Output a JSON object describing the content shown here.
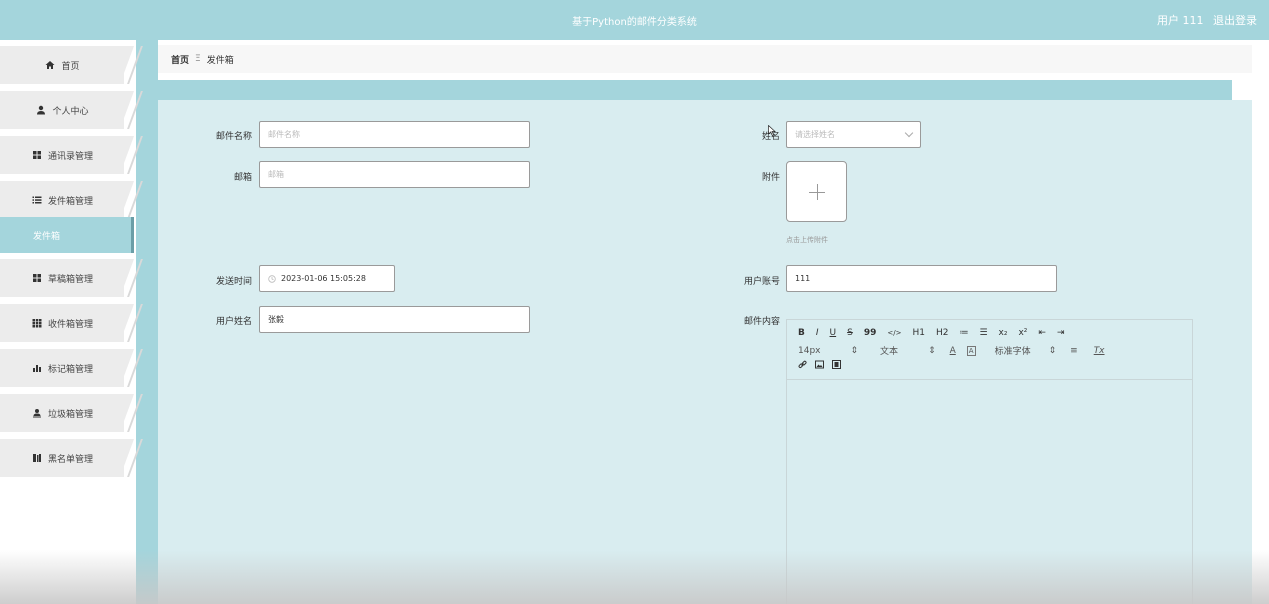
{
  "header": {
    "title": "基于Python的邮件分类系统",
    "user_label": "用户 111",
    "logout_label": "退出登录"
  },
  "sidebar": {
    "items": [
      {
        "label": "首页",
        "icon": "home-icon"
      },
      {
        "label": "个人中心",
        "icon": "user-icon"
      },
      {
        "label": "通讯录管理",
        "icon": "grid-icon"
      },
      {
        "label": "发件箱管理",
        "icon": "list-icon"
      },
      {
        "label": "草稿箱管理",
        "icon": "grid-icon"
      },
      {
        "label": "收件箱管理",
        "icon": "grid-icon"
      },
      {
        "label": "标记箱管理",
        "icon": "bar-chart-icon"
      },
      {
        "label": "垃圾箱管理",
        "icon": "user-tag-icon"
      },
      {
        "label": "黑名单管理",
        "icon": "book-icon"
      }
    ],
    "sub_item": "发件箱"
  },
  "breadcrumb": {
    "home": "首页",
    "separator": "Ξ",
    "current": "发件箱"
  },
  "form": {
    "mail_name_label": "邮件名称",
    "mail_name_placeholder": "邮件名称",
    "email_label": "邮箱",
    "email_placeholder": "邮箱",
    "name_label": "姓名",
    "name_placeholder": "请选择姓名",
    "attachment_label": "附件",
    "upload_tip": "点击上传附件",
    "send_time_label": "发送时间",
    "send_time_value": "2023-01-06 15:05:28",
    "user_account_label": "用户账号",
    "user_account_value": "111",
    "user_name_label": "用户姓名",
    "user_name_value": "张毅",
    "mail_content_label": "邮件内容"
  },
  "editor": {
    "row1": [
      "B",
      "I",
      "U",
      "S",
      "99",
      "</>",
      "H1",
      "H2",
      "≔",
      "☰",
      "x₂",
      "x²",
      "⇤",
      "⇥"
    ],
    "font_size": "14px",
    "text_style": "文本",
    "font_family": "标准字体",
    "row2_icons": [
      "A",
      "A"
    ],
    "align": "≡",
    "clear": "Tx",
    "row3": [
      "link",
      "image",
      "video"
    ]
  },
  "colors": {
    "header": "#a4d5dc",
    "panel": "#d9edf0"
  }
}
